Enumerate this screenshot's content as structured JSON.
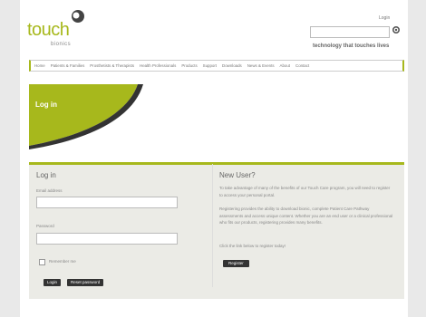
{
  "header": {
    "logo_text": "touch",
    "logo_sub": "bionics",
    "login_link": "Login",
    "search_value": "",
    "tagline": "technology that touches lives"
  },
  "nav": {
    "items": [
      "Home",
      "Patients & Families",
      "Prosthetists & Therapists",
      "Health Professionals",
      "Products",
      "Support",
      "Downloads",
      "News & Events",
      "About",
      "Contact"
    ]
  },
  "hero": {
    "title": "Log in"
  },
  "login": {
    "title": "Log in",
    "email_label": "Email address",
    "email_value": "",
    "password_label": "Password",
    "password_value": "",
    "remember_label": "Remember me",
    "login_button": "Login",
    "reset_button": "Reset password"
  },
  "new_user": {
    "title": "New User?",
    "paragraphs": [
      "To take advantage of many of the benefits of our Touch Care program, you will need to register to access your personal portal.",
      "Registering provides the ability to download bionic, complete Patient Care Pathway assessments and access unique content. Whether you are an end user or a clinical professional who fits our products, registering provides many benefits.",
      "Click the link below to register today!"
    ],
    "register_button": "Register"
  },
  "colors": {
    "brand": "#a7b81c",
    "button": "#333333"
  }
}
